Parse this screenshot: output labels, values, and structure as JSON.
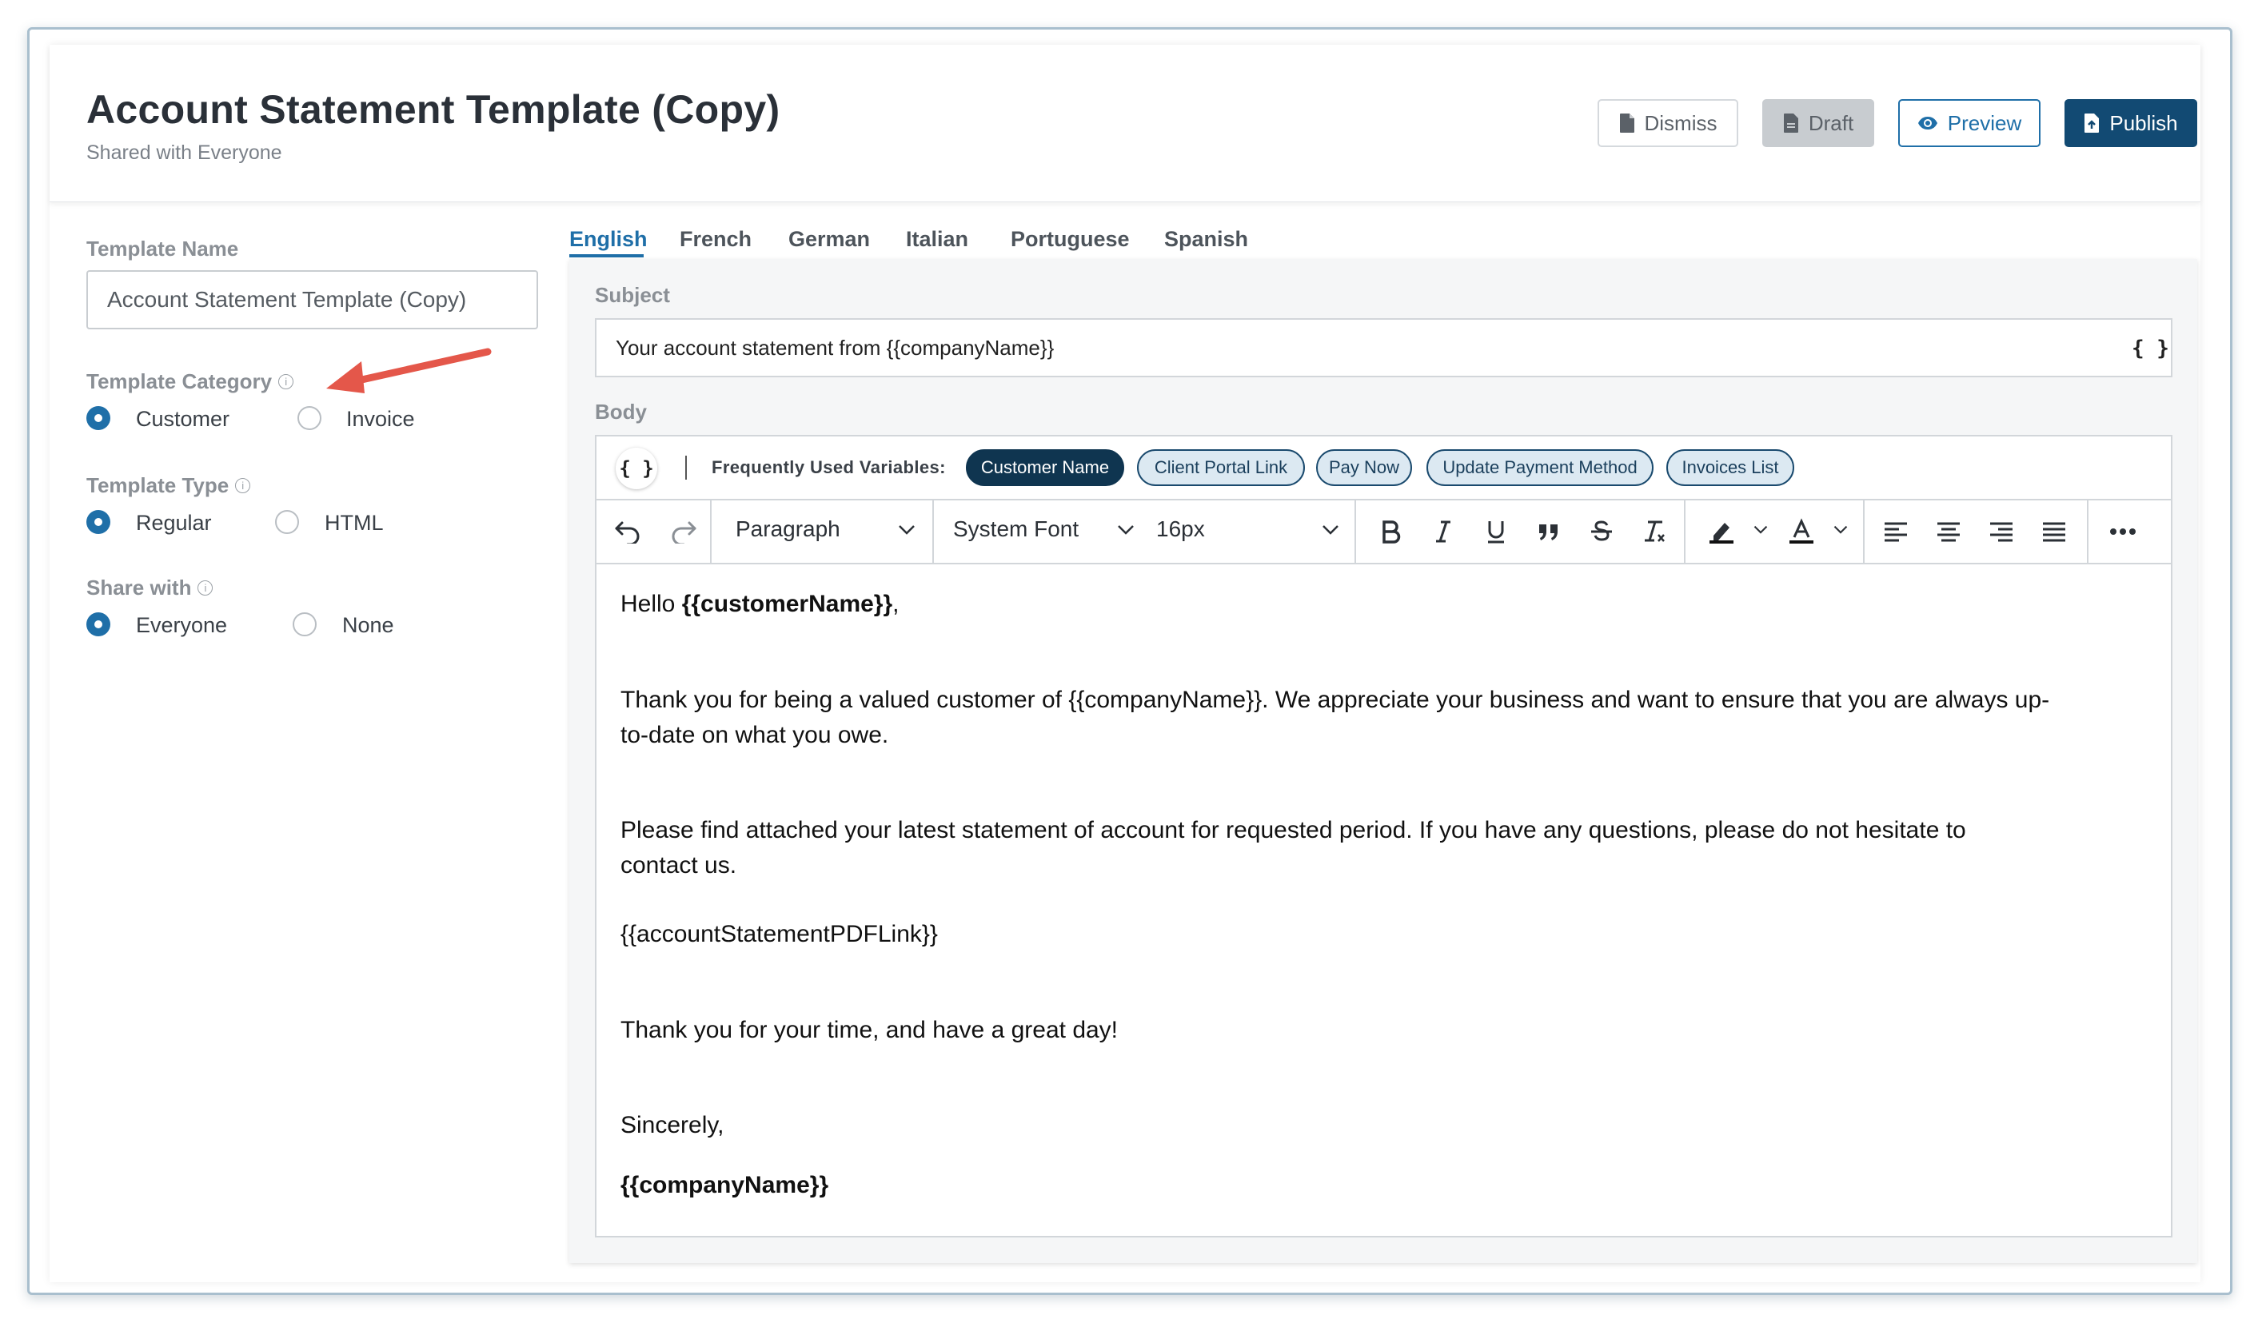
{
  "header": {
    "title": "Account Statement Template (Copy)",
    "subtitle": "Shared with Everyone",
    "buttons": {
      "dismiss": "Dismiss",
      "draft": "Draft",
      "preview": "Preview",
      "publish": "Publish"
    }
  },
  "form": {
    "template_name": {
      "label": "Template Name",
      "value": "Account Statement Template (Copy)"
    },
    "category": {
      "label": "Template Category",
      "options": [
        "Customer",
        "Invoice"
      ],
      "selected": "Customer"
    },
    "type": {
      "label": "Template Type",
      "options": [
        "Regular",
        "HTML"
      ],
      "selected": "Regular"
    },
    "share": {
      "label": "Share with",
      "options": [
        "Everyone",
        "None"
      ],
      "selected": "Everyone"
    },
    "info_glyph": "i"
  },
  "tabs": [
    "English",
    "French",
    "German",
    "Italian",
    "Portuguese",
    "Spanish"
  ],
  "active_tab": "English",
  "subject": {
    "label": "Subject",
    "value": "Your account statement from {{companyName}}",
    "var_button": "{ }"
  },
  "body": {
    "label": "Body",
    "var_button": "{ }",
    "frequent_label": "Frequently Used Variables:",
    "chips": [
      "Customer Name",
      "Client Portal Link",
      "Pay Now",
      "Update Payment Method",
      "Invoices List"
    ],
    "active_chip": "Customer Name",
    "toolbar": {
      "block_format": "Paragraph",
      "font": "System Font",
      "size": "16px"
    },
    "content": {
      "greeting_prefix": "Hello ",
      "greeting_var": "{{customerName}}",
      "greeting_suffix": ",",
      "para1_line1": "Thank you for being a valued customer of {{companyName}}. We appreciate your business and want to ensure that you are always up-",
      "para1_line2": "to-date on what you owe.",
      "para2_line1": "Please find attached your latest statement of account for requested period. If you have any questions, please do not hesitate to",
      "para2_line2": "contact us.",
      "pdf_link": "{{accountStatementPDFLink}}",
      "thanks": "Thank you for your time, and have a great day!",
      "closing": "Sincerely,",
      "signature": "{{companyName}}"
    }
  },
  "colors": {
    "primary": "#1f6fa8",
    "publish": "#124a73",
    "annotation_arrow": "#e4574a"
  }
}
